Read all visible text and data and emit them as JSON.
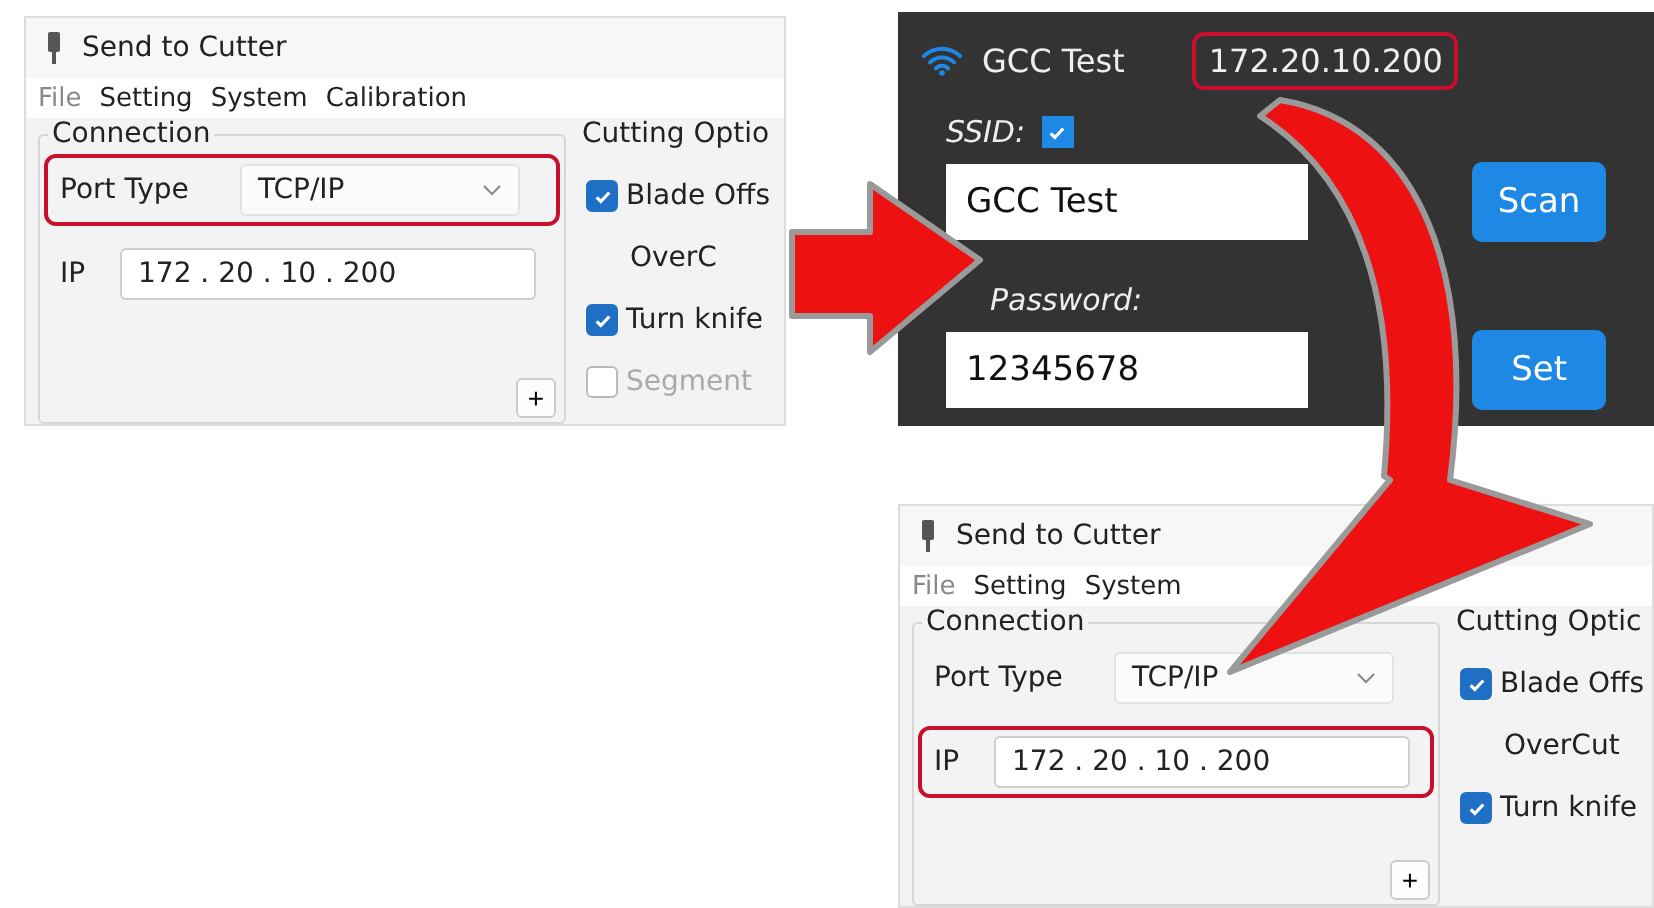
{
  "panels": [
    {
      "kind": "cutter",
      "title": "Send to Cutter",
      "menu": [
        {
          "label": "File",
          "disabled": true
        },
        {
          "label": "Setting",
          "disabled": false
        },
        {
          "label": "System",
          "disabled": false
        },
        {
          "label": "Calibration",
          "disabled": false
        }
      ],
      "connection": {
        "title": "Connection",
        "port_label": "Port Type",
        "port_value": "TCP/IP",
        "port_highlighted": true,
        "ip_label": "IP",
        "ip_value": "172 . 20 . 10 . 200",
        "ip_highlighted": false,
        "add_button": "+"
      },
      "cutting": {
        "title": "Cutting Optio",
        "options": [
          {
            "kind": "checkbox",
            "label": "Blade Offs",
            "checked": true,
            "disabled": false
          },
          {
            "kind": "plain",
            "label": "OverC"
          },
          {
            "kind": "checkbox",
            "label": "Turn knife",
            "checked": true,
            "disabled": false
          },
          {
            "kind": "checkbox",
            "label": "Segment",
            "checked": false,
            "disabled": true
          }
        ]
      }
    },
    {
      "kind": "wifi",
      "network": "GCC Test",
      "ip": "172.20.10.200",
      "ip_highlighted": true,
      "ssid_label": "SSID:",
      "ssid_checked": true,
      "ssid_value": "GCC Test",
      "scan_button": "Scan",
      "password_label": "Password:",
      "password_value": "12345678",
      "set_button": "Set"
    },
    {
      "kind": "cutter",
      "title": "Send to Cutter",
      "menu": [
        {
          "label": "File",
          "disabled": true
        },
        {
          "label": "Setting",
          "disabled": false
        },
        {
          "label": "System",
          "disabled": false
        }
      ],
      "connection": {
        "title": "Connection",
        "port_label": "Port Type",
        "port_value": "TCP/IP",
        "port_highlighted": false,
        "ip_label": "IP",
        "ip_value": "172 . 20 . 10 . 200",
        "ip_highlighted": true,
        "add_button": "+"
      },
      "cutting": {
        "title": "Cutting Optic",
        "options": [
          {
            "kind": "checkbox",
            "label": "Blade Offs",
            "checked": true,
            "disabled": false
          },
          {
            "kind": "plain",
            "label": "OverCut"
          },
          {
            "kind": "checkbox",
            "label": "Turn knife",
            "checked": true,
            "disabled": false
          }
        ]
      }
    }
  ]
}
